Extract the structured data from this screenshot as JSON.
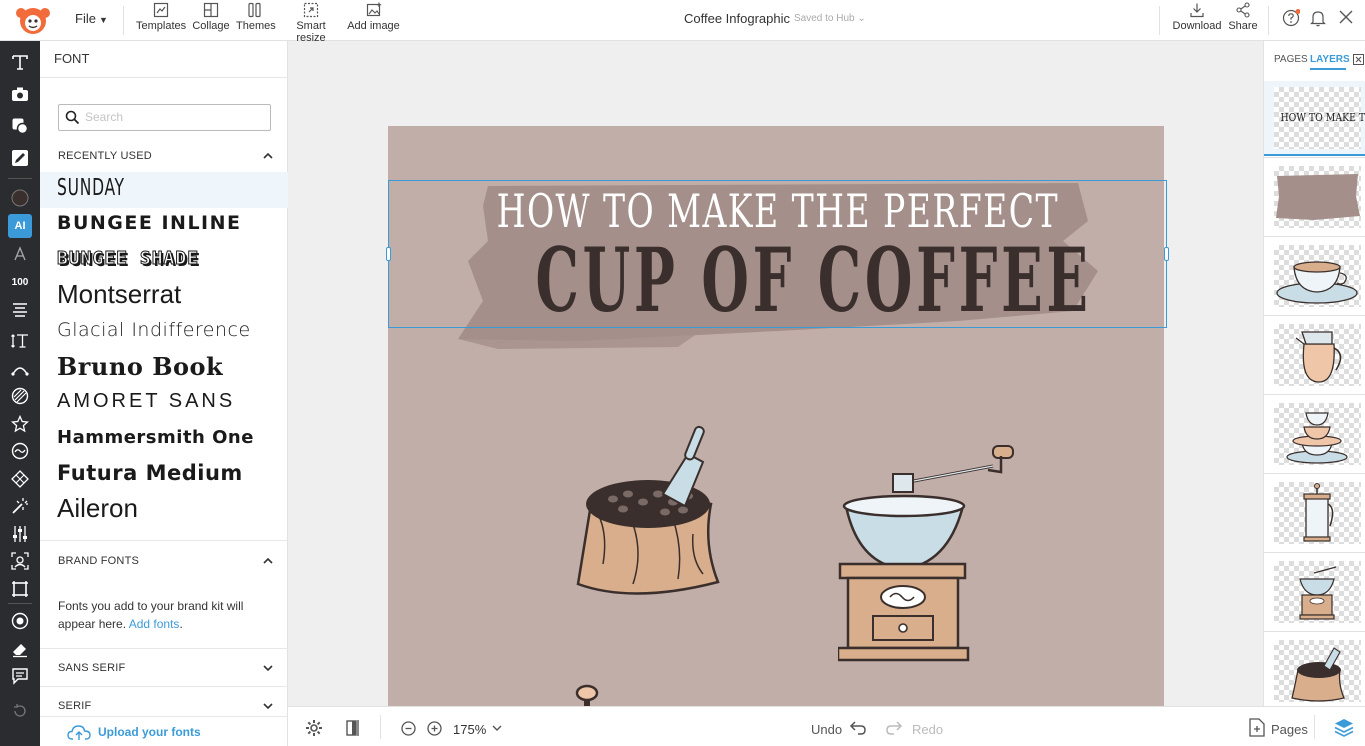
{
  "topbar": {
    "file_label": "File",
    "tools": [
      {
        "label": "Templates",
        "icon": "templates-icon"
      },
      {
        "label": "Collage",
        "icon": "collage-icon"
      },
      {
        "label": "Themes",
        "icon": "themes-icon"
      },
      {
        "label": "Smart resize",
        "icon": "smart-resize-icon"
      },
      {
        "label": "Add image",
        "icon": "add-image-icon"
      }
    ],
    "doc_title": "Coffee Infographic",
    "save_status": "Saved to Hub",
    "download_label": "Download",
    "share_label": "Share"
  },
  "iconbar": {
    "ai_label": "AI",
    "size_label": "100"
  },
  "font_panel": {
    "title": "FONT",
    "search_placeholder": "Search",
    "recently_used_header": "RECENTLY USED",
    "fonts": [
      "SUNDAY",
      "BUNGEE INLINE",
      "BUNGEE SHADE",
      "Montserrat",
      "Glacial Indifference",
      "Bruno Book",
      "AMORET SANS",
      "Hammersmith One",
      "Futura Medium",
      "Aileron"
    ],
    "brand_fonts_header": "BRAND FONTS",
    "brand_text": "Fonts you add to your brand kit will appear here.",
    "brand_link": "Add fonts",
    "sans_serif_header": "SANS SERIF",
    "serif_header": "SERIF",
    "upload_label": "Upload your fonts"
  },
  "canvas": {
    "headline_line1": "HOW TO MAKE THE PERFECT",
    "headline_line2": "CUP OF COFFEE",
    "colors": {
      "background": "#c1aea9",
      "brush": "#a48f8a",
      "line1": "#ffffff",
      "line2": "#3a2f2c"
    }
  },
  "bottombar": {
    "zoom": "175%",
    "undo_label": "Undo",
    "redo_label": "Redo",
    "pages_label": "Pages"
  },
  "right_panel": {
    "tab_pages": "PAGES",
    "tab_layers": "LAYERS",
    "layer1_text": "HOW TO MAKE THE",
    "layers": [
      "text-layer",
      "brush-layer",
      "cup-layer",
      "kettle-layer",
      "stacked-cups-layer",
      "french-press-layer",
      "grinder-layer",
      "bean-sack-layer"
    ]
  },
  "accent_color": "#3b9bd9"
}
